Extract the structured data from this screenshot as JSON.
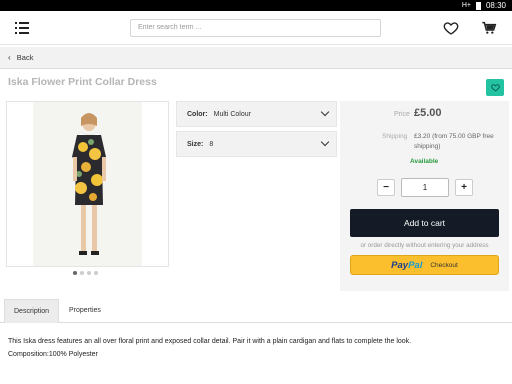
{
  "status_bar": {
    "signal": "H+",
    "time": "08:30"
  },
  "search": {
    "placeholder": "Enter search term ..."
  },
  "nav": {
    "back_label": "Back"
  },
  "product": {
    "title": "Iska Flower Print Collar Dress",
    "gallery": {
      "image_count": 4,
      "active_index": 0
    },
    "variants": [
      {
        "label": "Color:",
        "value": "Multi Colour"
      },
      {
        "label": "Size:",
        "value": "8"
      }
    ],
    "price_label": "Price",
    "price": "£5.00",
    "shipping_label": "Shipping",
    "shipping_text": "£3.20 (from 75.00 GBP free shipping)",
    "availability": "Available",
    "quantity": "1",
    "minus_label": "−",
    "plus_label": "+",
    "add_to_cart_label": "Add to cart",
    "or_direct_text": "or order directly without entering your address",
    "paypal_brand_1": "Pay",
    "paypal_brand_2": "Pal",
    "paypal_checkout_label": "Checkout"
  },
  "tabs": [
    {
      "label": "Description",
      "active": true
    },
    {
      "label": "Properties",
      "active": false
    }
  ],
  "description": {
    "text": "This Iska dress features an all over floral print and exposed collar detail. Pair it with a plain cardigan and flats to complete the look.",
    "composition": "Composition:100% Polyester"
  },
  "colors": {
    "accent": "#23c3a2",
    "cart_button": "#141b26",
    "paypal_button": "#fbbf2d",
    "available": "#2a9b3f"
  },
  "icons": [
    "menu-icon",
    "heart-icon",
    "cart-icon",
    "chevron-left-icon",
    "chevron-down-icon",
    "battery-icon"
  ]
}
